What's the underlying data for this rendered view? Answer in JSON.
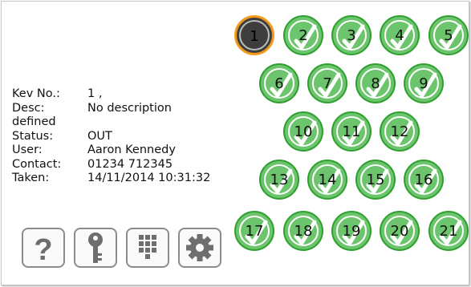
{
  "key_info": {
    "key_no_label": "Kev No.:",
    "key_no_value": "1 ,",
    "desc_label": "Desc:",
    "desc_value": "No description",
    "desc_value_wrap": "defined",
    "status_label": "Status:",
    "status_value": "OUT",
    "user_label": "User:",
    "user_value": "Aaron Kennedy",
    "contact_label": "Contact:",
    "contact_value": "01234 712345",
    "taken_label": "Taken:",
    "taken_value": "14/11/2014 10:31:32"
  },
  "keys": [
    {
      "number": "1",
      "status": "out"
    },
    {
      "number": "2",
      "status": "available"
    },
    {
      "number": "3",
      "status": "available"
    },
    {
      "number": "4",
      "status": "available"
    },
    {
      "number": "5",
      "status": "available"
    },
    {
      "number": "6",
      "status": "available"
    },
    {
      "number": "7",
      "status": "available"
    },
    {
      "number": "8",
      "status": "available"
    },
    {
      "number": "9",
      "status": "available"
    },
    {
      "number": "10",
      "status": "available"
    },
    {
      "number": "11",
      "status": "available"
    },
    {
      "number": "12",
      "status": "available"
    },
    {
      "number": "13",
      "status": "available"
    },
    {
      "number": "14",
      "status": "available"
    },
    {
      "number": "15",
      "status": "available"
    },
    {
      "number": "16",
      "status": "available"
    },
    {
      "number": "17",
      "status": "available"
    },
    {
      "number": "18",
      "status": "available"
    },
    {
      "number": "19",
      "status": "available"
    },
    {
      "number": "20",
      "status": "available"
    },
    {
      "number": "21",
      "status": "available"
    }
  ],
  "toolbar": [
    {
      "icon": "help-icon"
    },
    {
      "icon": "key-icon"
    },
    {
      "icon": "keypad-icon"
    },
    {
      "icon": "gear-icon"
    }
  ],
  "colors": {
    "available_fill": "#6cc46c",
    "available_ring": "#2fa02f",
    "out_fill": "#3e3e3e",
    "out_ring": "#f29a1e",
    "button_border": "#8c8c8c",
    "icon_gray": "#6e6e6e"
  }
}
